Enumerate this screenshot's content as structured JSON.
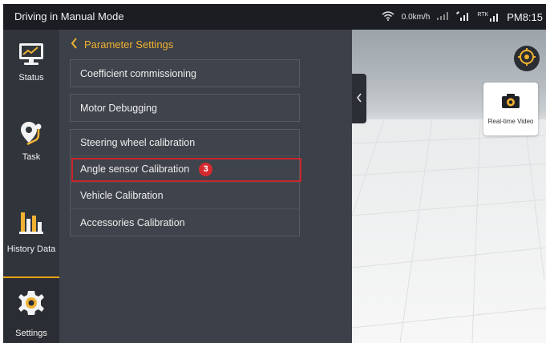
{
  "status_bar": {
    "title": "Driving in Manual Mode",
    "speed": "0.0km/h",
    "rtk_label": "RTK",
    "clock": "PM8:15"
  },
  "sidebar": {
    "items": [
      {
        "label": "Status",
        "icon": "status-monitor-icon"
      },
      {
        "label": "Task",
        "icon": "task-route-icon"
      },
      {
        "label": "History Data",
        "icon": "history-chart-icon"
      },
      {
        "label": "Settings",
        "icon": "settings-gear-icon",
        "active": true
      }
    ]
  },
  "panel": {
    "header": "Parameter Settings",
    "group1": [
      "Coefficient commissioning"
    ],
    "group2": [
      "Motor Debugging"
    ],
    "group3": [
      "Steering wheel calibration",
      "Angle sensor Calibration",
      "Vehicle Calibration",
      "Accessories Calibration"
    ],
    "highlight_badge": "3"
  },
  "scene": {
    "video_label": "Real-time Video"
  },
  "colors": {
    "accent": "#f0b230",
    "highlight": "#c8262c",
    "sidebar_bg": "#30343b",
    "panel_bg": "#3c4048"
  }
}
